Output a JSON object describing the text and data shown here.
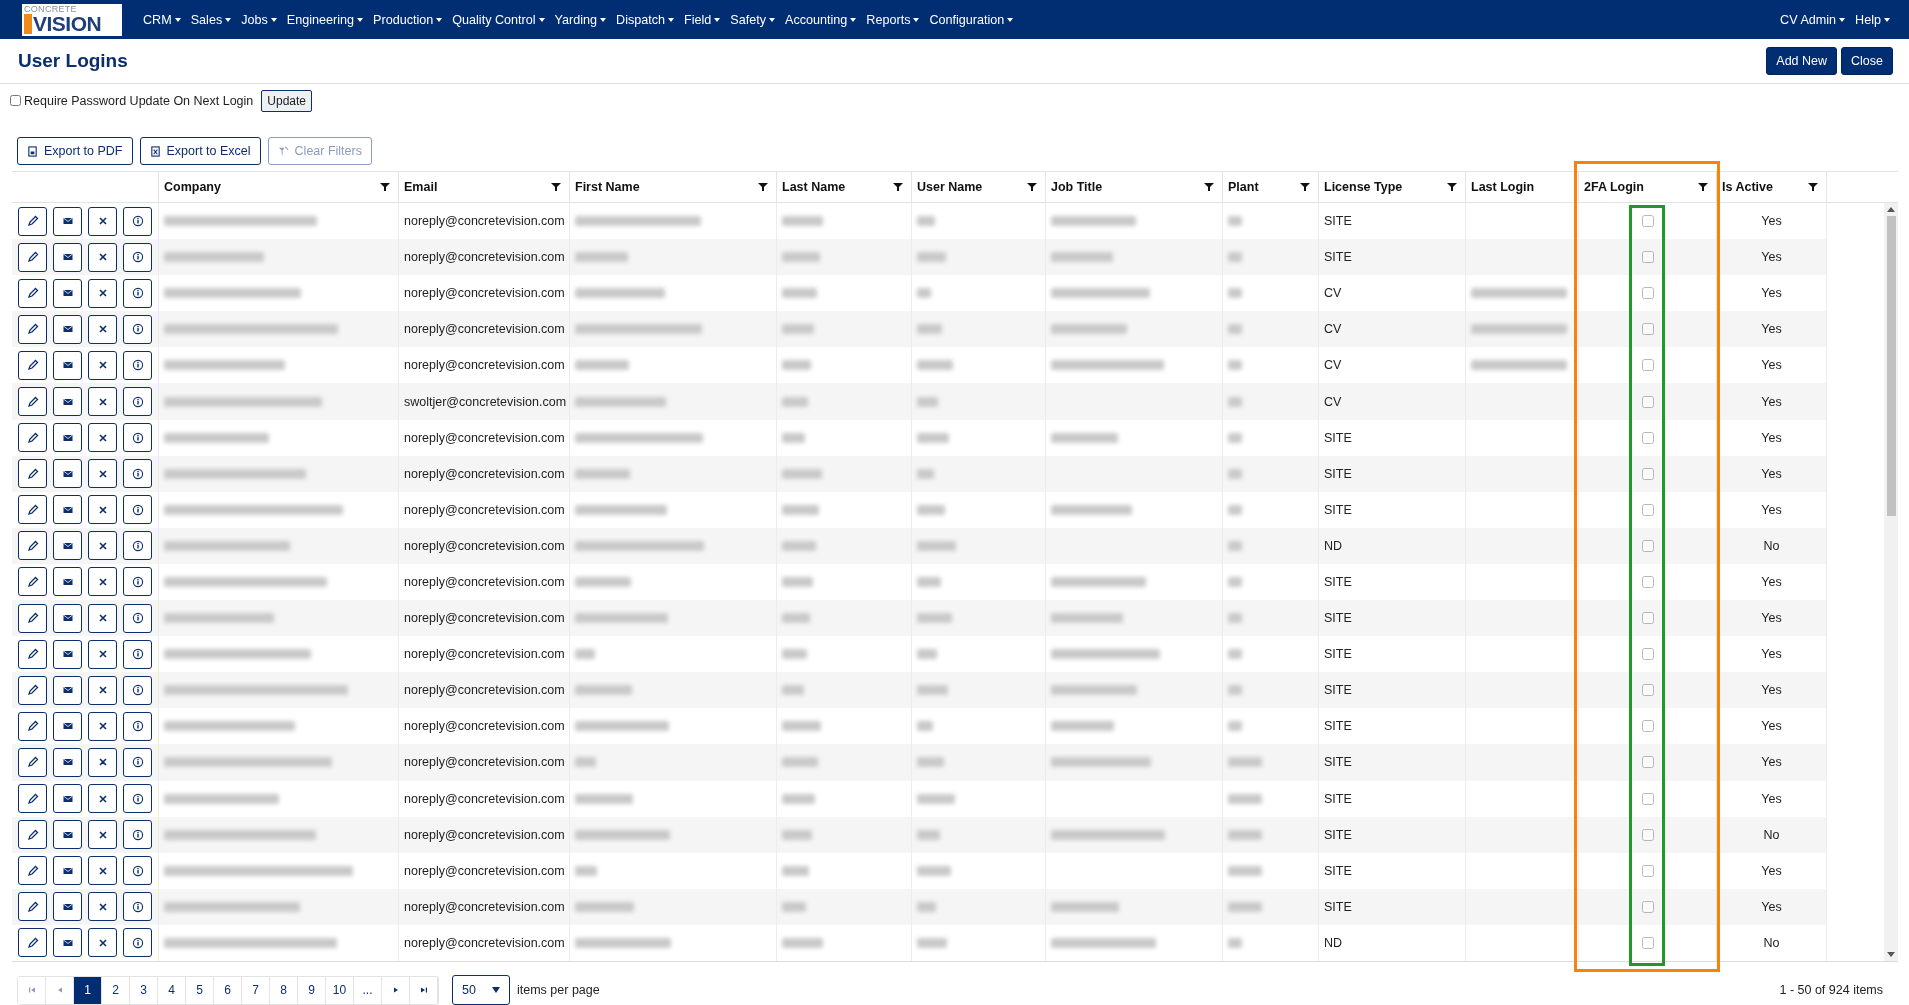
{
  "nav": {
    "menus": [
      "CRM",
      "Sales",
      "Jobs",
      "Engineering",
      "Production",
      "Quality Control",
      "Yarding",
      "Dispatch",
      "Field",
      "Safety",
      "Accounting",
      "Reports",
      "Configuration"
    ],
    "right_menus": [
      "CV Admin",
      "Help"
    ],
    "logo": {
      "top": "CONCRETE",
      "main": "VISION"
    }
  },
  "page": {
    "title": "User Logins",
    "buttons": [
      "Add New",
      "Close"
    ]
  },
  "password_option": {
    "label": "Require Password Update On Next Login",
    "checked": false,
    "button": "Update"
  },
  "toolbar": [
    {
      "kind": "pdf",
      "label": "Export to PDF",
      "disabled": false
    },
    {
      "kind": "excel",
      "label": "Export to Excel",
      "disabled": false
    },
    {
      "kind": "clear",
      "label": "Clear Filters",
      "disabled": true
    }
  ],
  "table": {
    "columns": [
      {
        "label": "Company",
        "filter": true,
        "highlighted": false
      },
      {
        "label": "Email",
        "filter": true,
        "highlighted": false
      },
      {
        "label": "First Name",
        "filter": true,
        "highlighted": false
      },
      {
        "label": "Last Name",
        "filter": true,
        "highlighted": false
      },
      {
        "label": "User Name",
        "filter": true,
        "highlighted": false
      },
      {
        "label": "Job Title",
        "filter": true,
        "highlighted": false
      },
      {
        "label": "Plant",
        "filter": true,
        "highlighted": false
      },
      {
        "label": "License Type",
        "filter": true,
        "highlighted": false
      },
      {
        "label": "Last Login",
        "filter": false,
        "highlighted": false
      },
      {
        "label": "2FA Login",
        "filter": true,
        "highlighted": true
      },
      {
        "label": "Is Active",
        "filter": true,
        "highlighted": false
      }
    ],
    "rows": [
      {
        "email": "noreply@concretevision.com",
        "job_title_shown": true,
        "license_type": "SITE",
        "last_login_shown": false,
        "two_factor": false,
        "is_active": "Yes"
      },
      {
        "email": "noreply@concretevision.com",
        "job_title_shown": true,
        "license_type": "SITE",
        "last_login_shown": false,
        "two_factor": false,
        "is_active": "Yes"
      },
      {
        "email": "noreply@concretevision.com",
        "job_title_shown": true,
        "license_type": "CV",
        "last_login_shown": true,
        "two_factor": false,
        "is_active": "Yes"
      },
      {
        "email": "noreply@concretevision.com",
        "job_title_shown": true,
        "license_type": "CV",
        "last_login_shown": true,
        "two_factor": false,
        "is_active": "Yes"
      },
      {
        "email": "noreply@concretevision.com",
        "job_title_shown": true,
        "license_type": "CV",
        "last_login_shown": true,
        "two_factor": false,
        "is_active": "Yes"
      },
      {
        "email": "swoltjer@concretevision.com",
        "job_title_shown": false,
        "license_type": "CV",
        "last_login_shown": false,
        "two_factor": false,
        "is_active": "Yes"
      },
      {
        "email": "noreply@concretevision.com",
        "job_title_shown": true,
        "license_type": "SITE",
        "last_login_shown": false,
        "two_factor": false,
        "is_active": "Yes"
      },
      {
        "email": "noreply@concretevision.com",
        "job_title_shown": false,
        "license_type": "SITE",
        "last_login_shown": false,
        "two_factor": false,
        "is_active": "Yes"
      },
      {
        "email": "noreply@concretevision.com",
        "job_title_shown": true,
        "license_type": "SITE",
        "last_login_shown": false,
        "two_factor": false,
        "is_active": "Yes"
      },
      {
        "email": "noreply@concretevision.com",
        "job_title_shown": false,
        "license_type": "ND",
        "last_login_shown": false,
        "two_factor": false,
        "is_active": "No"
      },
      {
        "email": "noreply@concretevision.com",
        "job_title_shown": true,
        "license_type": "SITE",
        "last_login_shown": false,
        "two_factor": false,
        "is_active": "Yes"
      },
      {
        "email": "noreply@concretevision.com",
        "job_title_shown": true,
        "license_type": "SITE",
        "last_login_shown": false,
        "two_factor": false,
        "is_active": "Yes"
      },
      {
        "email": "noreply@concretevision.com",
        "job_title_shown": true,
        "license_type": "SITE",
        "last_login_shown": false,
        "two_factor": false,
        "is_active": "Yes"
      },
      {
        "email": "noreply@concretevision.com",
        "job_title_shown": true,
        "license_type": "SITE",
        "last_login_shown": false,
        "two_factor": false,
        "is_active": "Yes"
      },
      {
        "email": "noreply@concretevision.com",
        "job_title_shown": true,
        "license_type": "SITE",
        "last_login_shown": false,
        "two_factor": false,
        "is_active": "Yes"
      },
      {
        "email": "noreply@concretevision.com",
        "job_title_shown": true,
        "license_type": "SITE",
        "last_login_shown": false,
        "two_factor": false,
        "is_active": "Yes"
      },
      {
        "email": "noreply@concretevision.com",
        "job_title_shown": false,
        "license_type": "SITE",
        "last_login_shown": false,
        "two_factor": false,
        "is_active": "Yes"
      },
      {
        "email": "noreply@concretevision.com",
        "job_title_shown": true,
        "license_type": "SITE",
        "last_login_shown": false,
        "two_factor": false,
        "is_active": "No"
      },
      {
        "email": "noreply@concretevision.com",
        "job_title_shown": false,
        "license_type": "SITE",
        "last_login_shown": false,
        "two_factor": false,
        "is_active": "Yes"
      },
      {
        "email": "noreply@concretevision.com",
        "job_title_shown": true,
        "license_type": "SITE",
        "last_login_shown": false,
        "two_factor": false,
        "is_active": "Yes"
      },
      {
        "email": "noreply@concretevision.com",
        "job_title_shown": true,
        "license_type": "ND",
        "last_login_shown": false,
        "two_factor": false,
        "is_active": "No"
      }
    ]
  },
  "pager": {
    "pages": [
      {
        "label": "1",
        "selected": true
      },
      {
        "label": "2",
        "selected": false
      },
      {
        "label": "3",
        "selected": false
      },
      {
        "label": "4",
        "selected": false
      },
      {
        "label": "5",
        "selected": false
      },
      {
        "label": "6",
        "selected": false
      },
      {
        "label": "7",
        "selected": false
      },
      {
        "label": "8",
        "selected": false
      },
      {
        "label": "9",
        "selected": false
      },
      {
        "label": "10",
        "selected": false
      },
      {
        "label": "...",
        "selected": false
      }
    ],
    "page_size": "50",
    "page_size_label": "items per page",
    "summary": "1 - 50 of 924 items"
  }
}
